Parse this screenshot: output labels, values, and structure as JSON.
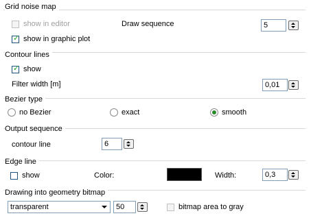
{
  "grid_noise_map": {
    "title": "Grid noise map",
    "show_in_editor": {
      "label": "show in editor",
      "checked": false,
      "enabled": false
    },
    "draw_sequence_label": "Draw sequence",
    "draw_sequence_value": "5",
    "show_in_graphic_plot": {
      "label": "show in graphic plot",
      "checked": true
    }
  },
  "contour_lines": {
    "title": "Contour lines",
    "show": {
      "label": "show",
      "checked": true
    },
    "filter_width_label": "Filter width [m]",
    "filter_width_value": "0,01"
  },
  "bezier_type": {
    "title": "Bezier type",
    "options": [
      {
        "label": "no Bezier",
        "selected": false
      },
      {
        "label": "exact",
        "selected": false
      },
      {
        "label": "smooth",
        "selected": true
      }
    ]
  },
  "output_sequence": {
    "title": "Output sequence",
    "contour_line_label": "contour line",
    "contour_line_value": "6"
  },
  "edge_line": {
    "title": "Edge line",
    "show": {
      "label": "show",
      "checked": false
    },
    "color_label": "Color:",
    "color_value": "#000000",
    "width_label": "Width:",
    "width_value": "0,3"
  },
  "geometry_bitmap": {
    "title": "Drawing into geometry bitmap",
    "mode_value": "transparent",
    "amount_value": "50",
    "bitmap_gray": {
      "label": "bitmap area to gray",
      "checked": false
    }
  },
  "colors": {
    "check_mark": "#21a121",
    "radio_dot": "#2a8a2a",
    "separator": "#d8d8d8"
  }
}
